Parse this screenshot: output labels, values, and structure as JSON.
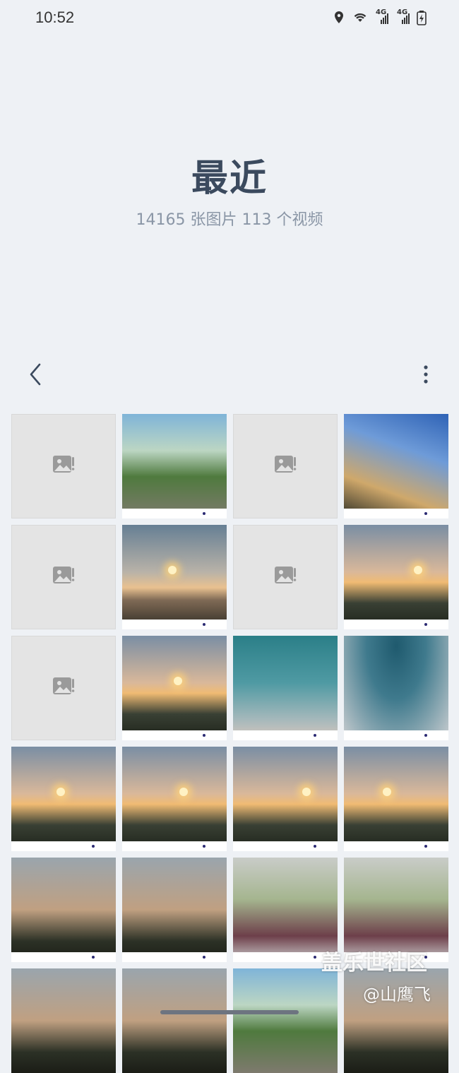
{
  "status_bar": {
    "time": "10:52",
    "icons": [
      "location-icon",
      "wifi-icon",
      "signal-4g-icon",
      "signal-4g-icon",
      "battery-icon"
    ],
    "network_label": "4G"
  },
  "album": {
    "title": "最近",
    "subtitle": "14165 张图片 113 个视频"
  },
  "toolbar": {
    "back_icon": "chevron-left-icon",
    "more_icon": "more-vertical-icon"
  },
  "grid": {
    "items": [
      {
        "type": "placeholder"
      },
      {
        "type": "photo",
        "scene": "park"
      },
      {
        "type": "placeholder"
      },
      {
        "type": "photo",
        "scene": "sky-blue"
      },
      {
        "type": "placeholder"
      },
      {
        "type": "photo",
        "scene": "sky-dawn"
      },
      {
        "type": "placeholder"
      },
      {
        "type": "photo",
        "scene": "sky-dusk"
      },
      {
        "type": "placeholder"
      },
      {
        "type": "photo",
        "scene": "sky-dusk"
      },
      {
        "type": "photo",
        "scene": "sky-teal"
      },
      {
        "type": "photo",
        "scene": "sky-teal2"
      },
      {
        "type": "photo",
        "scene": "sky-dusk"
      },
      {
        "type": "photo",
        "scene": "sky-dusk"
      },
      {
        "type": "photo",
        "scene": "sky-dusk"
      },
      {
        "type": "photo",
        "scene": "sky-dusk"
      },
      {
        "type": "photo",
        "scene": "trees"
      },
      {
        "type": "photo",
        "scene": "trees"
      },
      {
        "type": "photo",
        "scene": "road"
      },
      {
        "type": "photo",
        "scene": "road"
      },
      {
        "type": "photo",
        "scene": "trees"
      },
      {
        "type": "photo",
        "scene": "trees"
      },
      {
        "type": "photo",
        "scene": "park"
      },
      {
        "type": "photo",
        "scene": "trees"
      }
    ]
  },
  "watermark": {
    "line1": "盖乐世社区",
    "line2": "@山鹰飞"
  }
}
